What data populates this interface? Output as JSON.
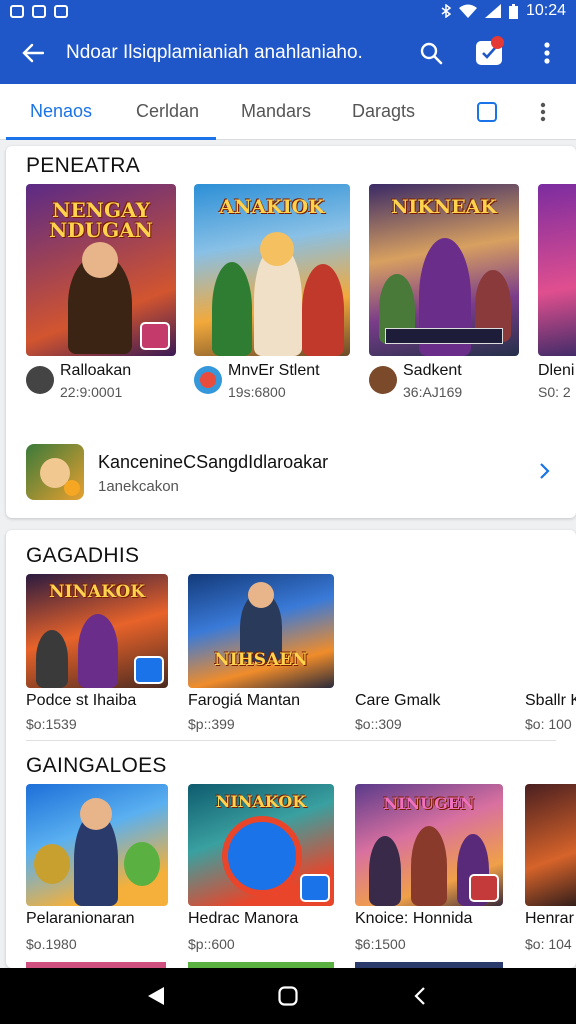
{
  "status_bar": {
    "time": "10:24"
  },
  "app_bar": {
    "title": "Ndoar Ilsiqplamianiah anahlaniaho."
  },
  "tabs": [
    {
      "label": "Nenaos"
    },
    {
      "label": "Cerldan"
    },
    {
      "label": "Mandars"
    },
    {
      "label": "Daragts"
    }
  ],
  "section1": {
    "title": "PENEATRA",
    "tiles": [
      {
        "art": "NENGAY NDUGAN",
        "name": "Ralloakan",
        "sub": "22:9:0001",
        "colors": [
          "#5b2a86",
          "#e0733a"
        ]
      },
      {
        "art": "ANAKIOK",
        "name": "MnvEr Stlent",
        "sub": "19s:6800",
        "colors": [
          "#2c8fd6",
          "#f2a93b"
        ]
      },
      {
        "art": "NIKNEAK",
        "name": "Sadkent",
        "sub": "36:AJ169",
        "colors": [
          "#3a2a66",
          "#c65bd3"
        ]
      },
      {
        "art": "",
        "name": "Dleni",
        "sub": "S0: 2",
        "colors": [
          "#7b2ca0",
          "#e04f8f"
        ]
      }
    ],
    "promo": {
      "title": "KancenineCSangdIdlaroakar",
      "subtitle": "1anekcakon"
    }
  },
  "section2": {
    "title": "GAGADHIS",
    "tiles": [
      {
        "art": "NINAKOK",
        "name": "Podce st Ihaiba",
        "sub": "$o:1539",
        "colors": [
          "#2a1a40",
          "#e8632a"
        ]
      },
      {
        "art": "NIHSAEN",
        "name": "Farogiá Mantan",
        "sub": "$p::399",
        "colors": [
          "#133a7a",
          "#f08c2a"
        ]
      },
      {
        "art": "",
        "name": "Care Gmalk",
        "sub": "$o::309",
        "colors": []
      },
      {
        "art": "",
        "name": "Sballr K",
        "sub": "$o: 100",
        "colors": []
      }
    ]
  },
  "section3": {
    "title": "GAINGALOES",
    "tiles": [
      {
        "art": "",
        "name": "Pelaranionaran",
        "sub": "$o.1980",
        "colors": [
          "#1d6fd8",
          "#f4b03a"
        ]
      },
      {
        "art": "NINAKOK",
        "name": "Hedrac Manora",
        "sub": "$p::600",
        "colors": [
          "#0e5b6e",
          "#e8452a"
        ]
      },
      {
        "art": "NINUGEN",
        "name": "Knoice: Honnida",
        "sub": "$6:1500",
        "colors": [
          "#5a3a8a",
          "#f0a048"
        ]
      },
      {
        "art": "",
        "name": "Henrar",
        "sub": "$o: 104",
        "colors": [
          "#4a1f20",
          "#d6632a"
        ]
      }
    ]
  }
}
